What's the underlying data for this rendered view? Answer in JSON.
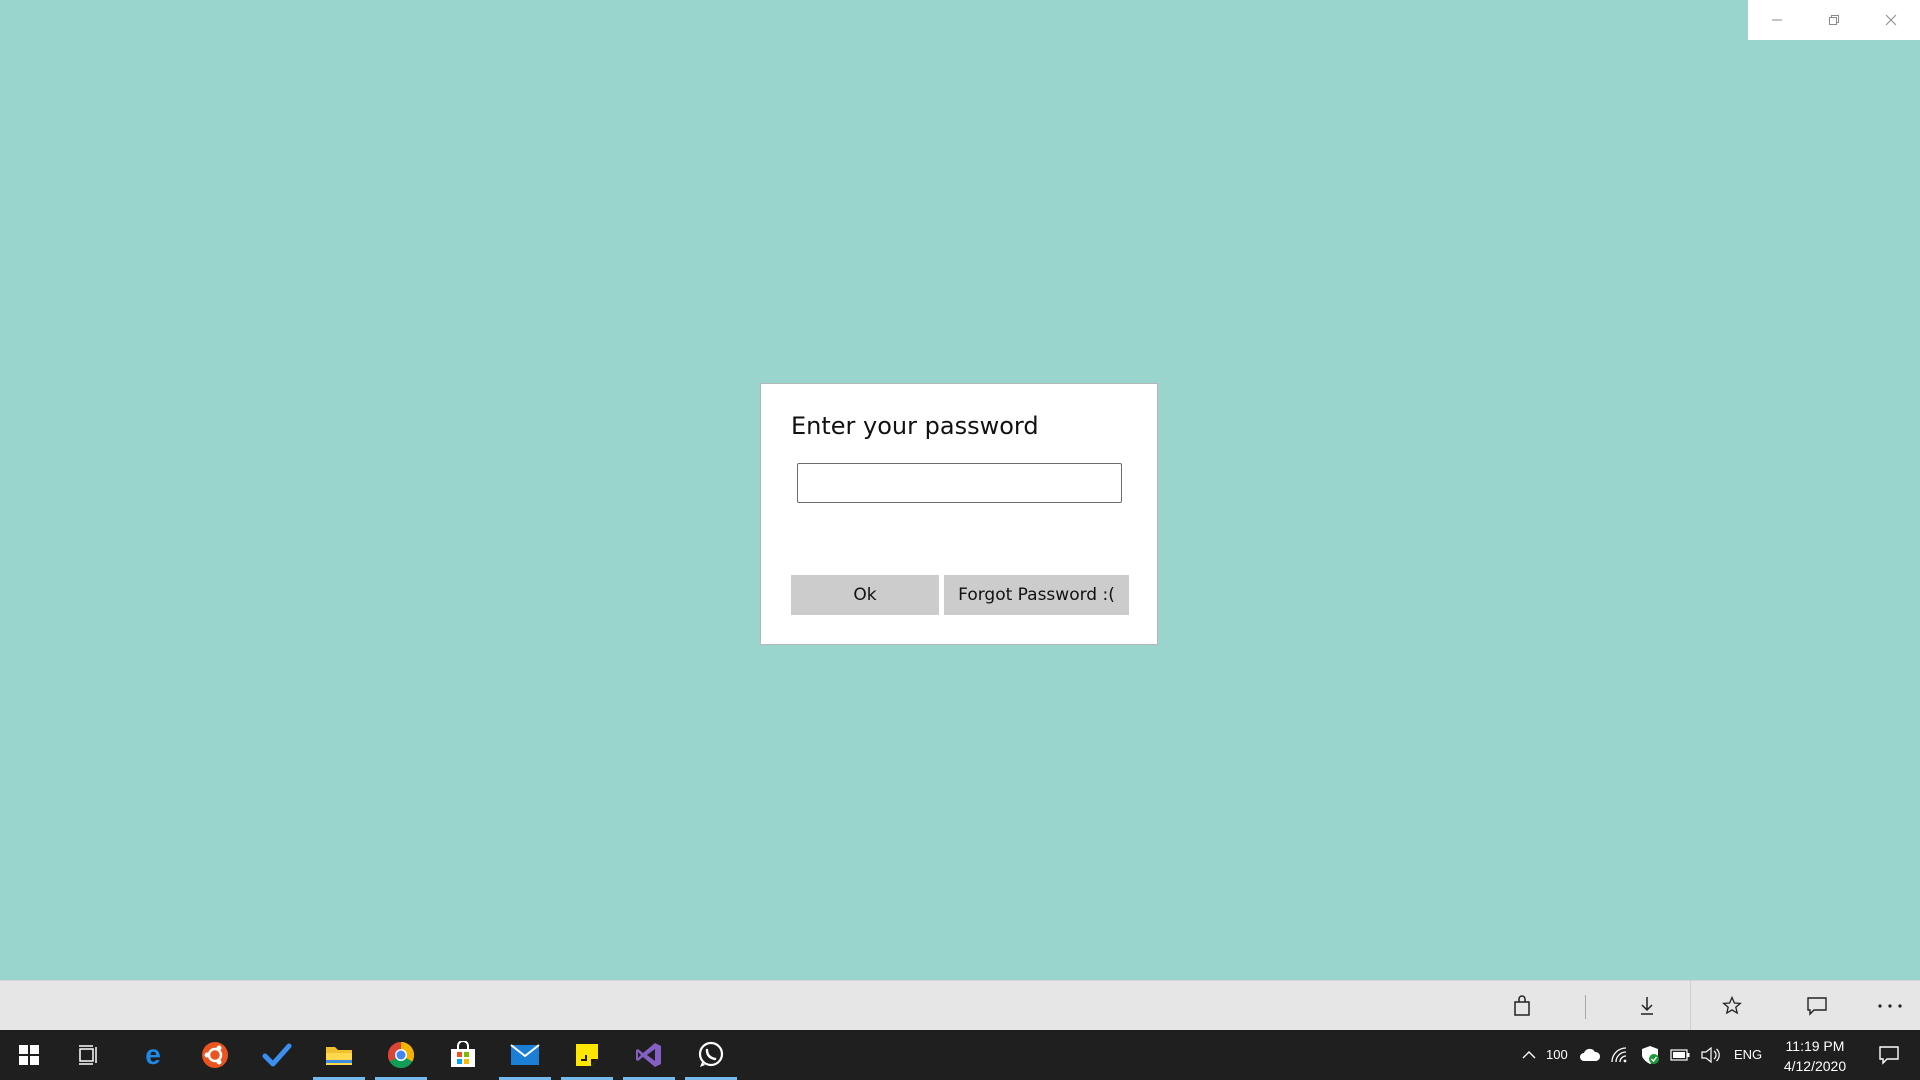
{
  "dialog": {
    "title": "Enter your password",
    "password_value": "",
    "ok_label": "Ok",
    "forgot_label": "Forgot Password :("
  },
  "window_controls": [
    "minimize-icon",
    "restore-icon",
    "close-icon"
  ],
  "appbar": {
    "items": [
      "bag-icon",
      "download-icon",
      "star-icon",
      "comment-icon",
      "more-icon"
    ]
  },
  "taskbar": {
    "apps": [
      "windows-start",
      "task-view",
      "edge",
      "ubuntu",
      "todo",
      "file-explorer",
      "chrome",
      "store",
      "mail",
      "sticky-notes",
      "visual-studio",
      "whatsapp"
    ],
    "battery_text": "100",
    "language": "ENG",
    "time": "11:19 PM",
    "date": "4/12/2020"
  },
  "colors": {
    "background": "#99d5cd",
    "taskbar": "#1f1f1f",
    "accent": "#0078d7"
  }
}
